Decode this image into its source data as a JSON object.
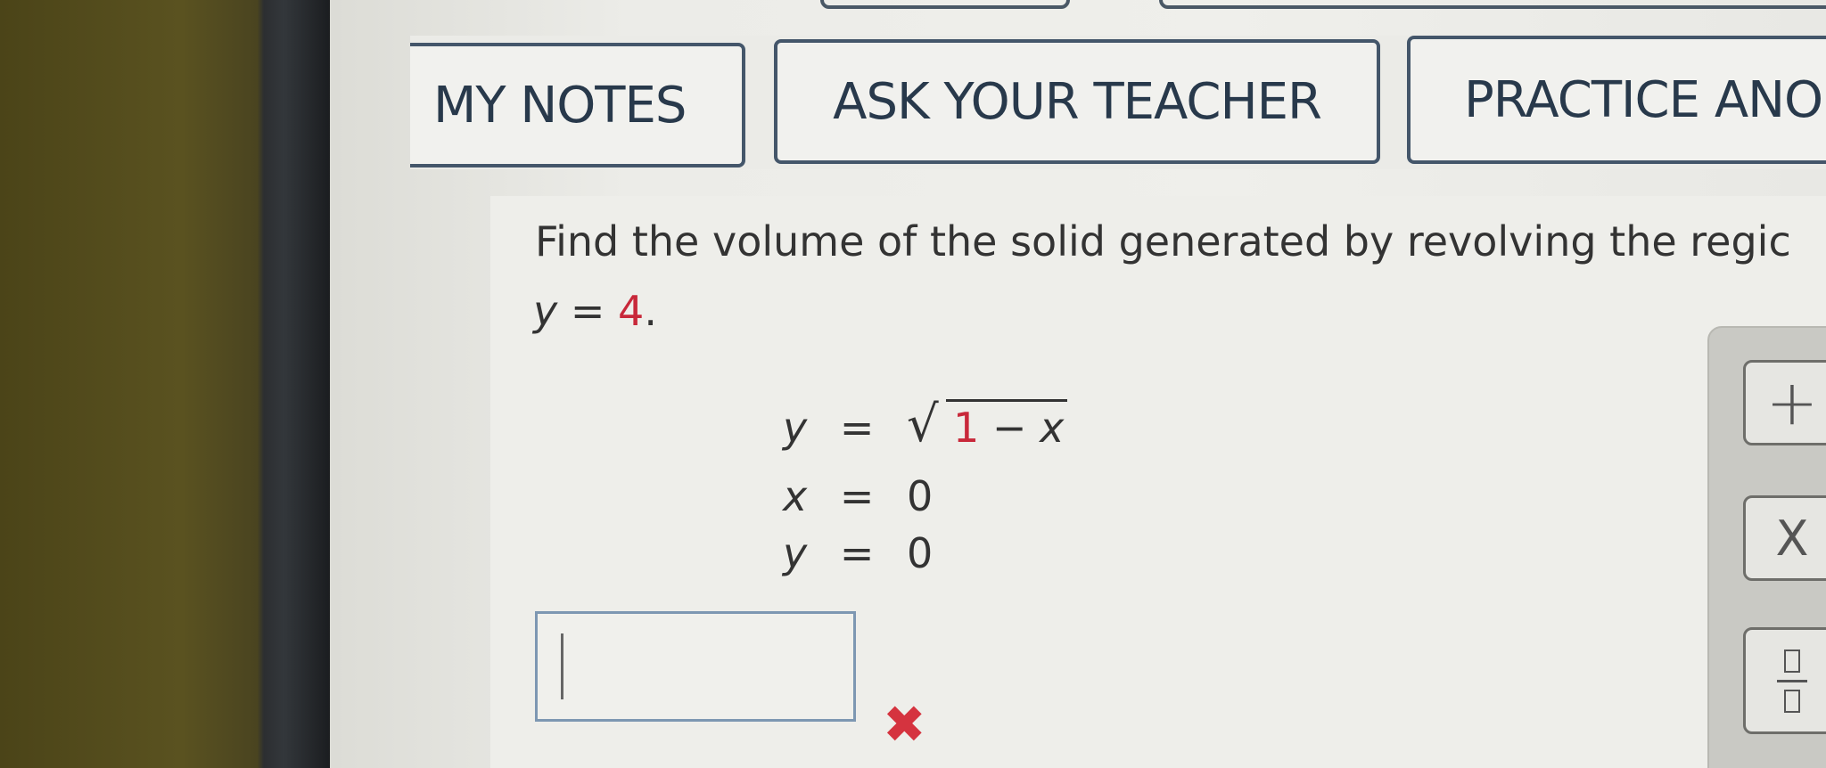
{
  "toolbar": {
    "my_notes": "MY NOTES",
    "ask_teacher": "ASK YOUR TEACHER",
    "practice": "PRACTICE ANO"
  },
  "question": {
    "text_line1": "Find the volume of the solid generated by revolving the regic",
    "line2_var": "y",
    "line2_eq": " = ",
    "line2_val": "4",
    "line2_end": "."
  },
  "equations": [
    {
      "lhs": "y",
      "eq": "=",
      "radicand_num": "1",
      "radicand_rest": " − x"
    },
    {
      "lhs": "x",
      "eq": "=",
      "rhs": "0"
    },
    {
      "lhs": "y",
      "eq": "=",
      "rhs": "0"
    }
  ],
  "answer": {
    "value": "",
    "status": "incorrect"
  },
  "palette": {
    "plus_label": "+",
    "times_label": "X",
    "fraction_icon": "fraction-icon"
  },
  "colors": {
    "accent_red": "#c8283a",
    "button_border": "#44566a"
  }
}
